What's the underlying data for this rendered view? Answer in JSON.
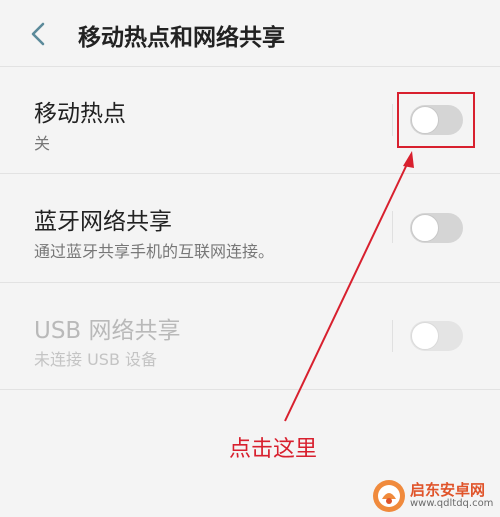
{
  "header": {
    "title": "移动热点和网络共享"
  },
  "settings": [
    {
      "title": "移动热点",
      "subtitle": "关",
      "enabled": true,
      "toggle_on": false
    },
    {
      "title": "蓝牙网络共享",
      "subtitle": "通过蓝牙共享手机的互联网连接。",
      "enabled": true,
      "toggle_on": false
    },
    {
      "title": "USB 网络共享",
      "subtitle": "未连接 USB 设备",
      "enabled": false,
      "toggle_on": false
    }
  ],
  "annotation": {
    "text": "点击这里",
    "color": "#d8202e"
  },
  "watermark": {
    "name": "启东安卓网",
    "url": "www.qdltdq.com"
  },
  "icons": [
    "back-chevron-icon"
  ]
}
